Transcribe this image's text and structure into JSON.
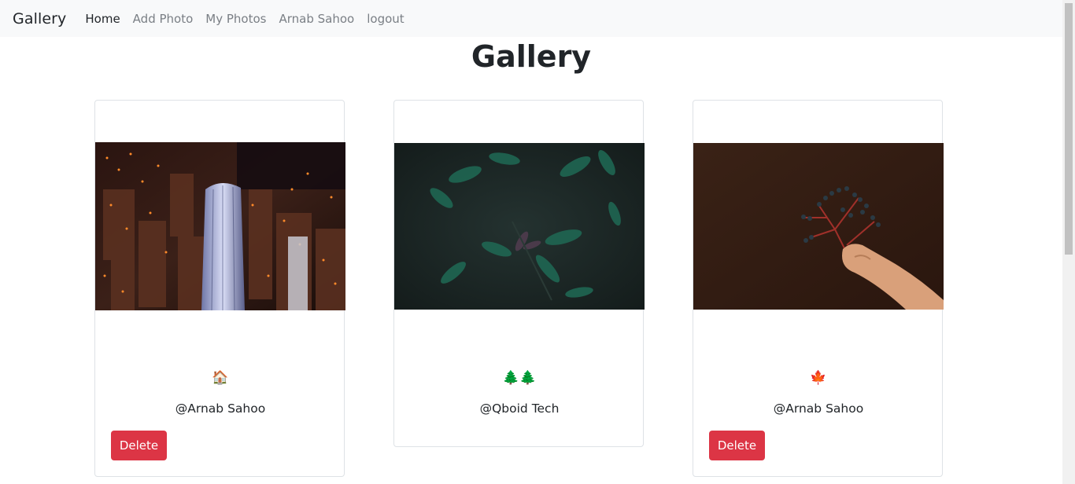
{
  "navbar": {
    "brand": "Gallery",
    "items": [
      {
        "label": "Home",
        "active": true
      },
      {
        "label": "Add Photo"
      },
      {
        "label": "My Photos"
      },
      {
        "label": "Arnab Sahoo"
      },
      {
        "label": "logout"
      }
    ]
  },
  "page": {
    "title": "Gallery"
  },
  "cards": [
    {
      "emoji": "🏠",
      "author": "@Arnab Sahoo",
      "delete_label": "Delete",
      "photo": "city-skyscraper-night-aerial"
    },
    {
      "emoji": "🌲🌲",
      "author": "@Qboid Tech",
      "photo": "green-leaves-dark"
    },
    {
      "emoji": "🍁",
      "author": "@Arnab Sahoo",
      "delete_label": "Delete",
      "photo": "hand-holding-red-berries"
    }
  ],
  "colors": {
    "navbar_bg": "#f8f9fa",
    "danger": "#dc3545",
    "card_border": "#dee2e6"
  }
}
